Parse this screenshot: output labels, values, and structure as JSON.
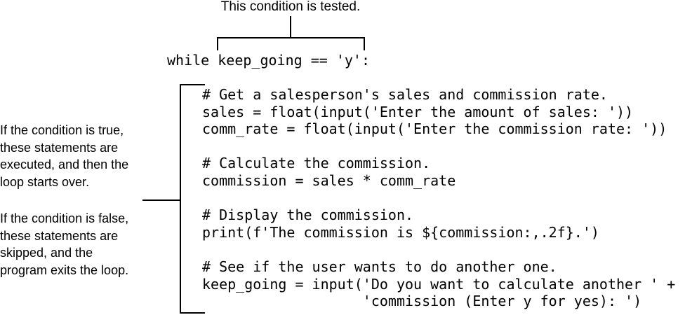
{
  "condition_label": "This condition is tested.",
  "while_line": "while keep_going == 'y':",
  "loop_body": [
    "# Get a salesperson's sales and commission rate.",
    "sales = float(input('Enter the amount of sales: '))",
    "comm_rate = float(input('Enter the commission rate: '))",
    "",
    "# Calculate the commission.",
    "commission = sales * comm_rate",
    "",
    "# Display the commission.",
    "print(f'The commission is ${commission:,.2f}.')",
    "",
    "# See if the user wants to do another one.",
    "keep_going = input('Do you want to calculate another ' +",
    "                   'commission (Enter y for yes): ')"
  ],
  "true_note": "If the condition is true,\nthese statements are\nexecuted, and then the\nloop starts over.",
  "false_note": "If the condition is false,\nthese statements are\nskipped, and the\nprogram exits the loop."
}
